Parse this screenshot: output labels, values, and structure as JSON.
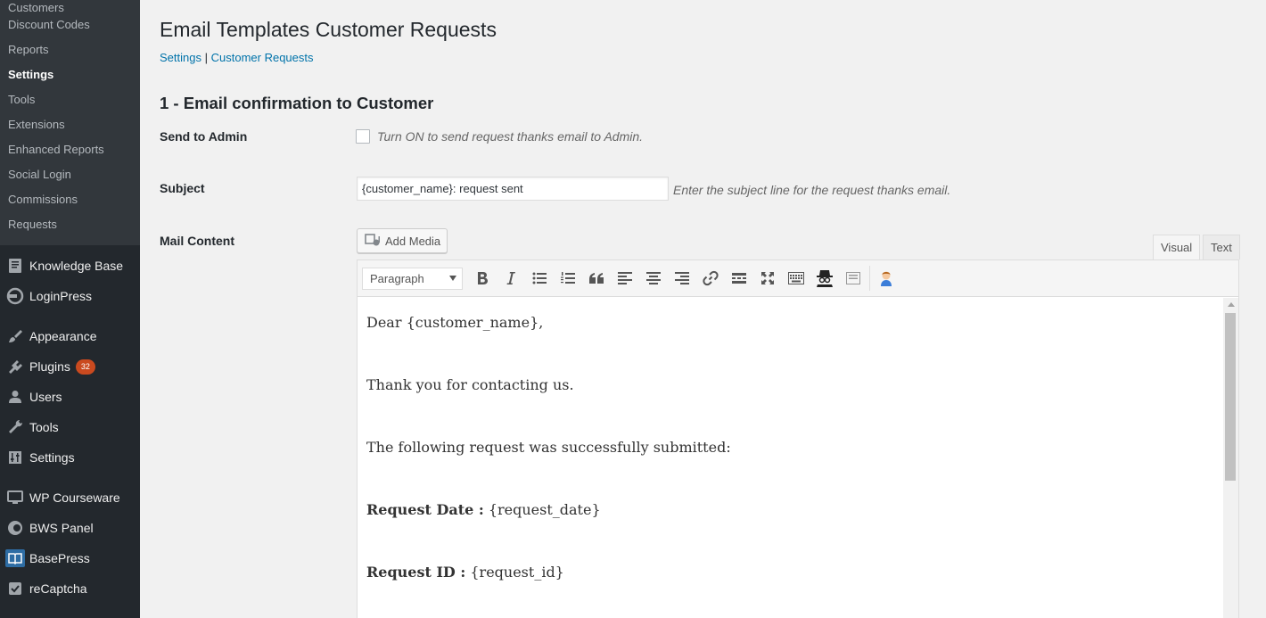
{
  "sidebar": {
    "submenu": [
      {
        "label": "Customers",
        "active": false
      },
      {
        "label": "Discount Codes",
        "active": false
      },
      {
        "label": "Reports",
        "active": false
      },
      {
        "label": "Settings",
        "active": true
      },
      {
        "label": "Tools",
        "active": false
      },
      {
        "label": "Extensions",
        "active": false
      },
      {
        "label": "Enhanced Reports",
        "active": false
      },
      {
        "label": "Social Login",
        "active": false
      },
      {
        "label": "Commissions",
        "active": false
      },
      {
        "label": "Requests",
        "active": false
      }
    ],
    "menu": [
      {
        "label": "Knowledge Base",
        "icon": "knowledge-base-icon"
      },
      {
        "label": "LoginPress",
        "icon": "loginpress-icon"
      },
      {
        "label": "Appearance",
        "icon": "paintbrush-icon"
      },
      {
        "label": "Plugins",
        "icon": "plugin-icon",
        "badge": "32"
      },
      {
        "label": "Users",
        "icon": "users-icon"
      },
      {
        "label": "Tools",
        "icon": "wrench-icon"
      },
      {
        "label": "Settings",
        "icon": "settings-icon"
      },
      {
        "label": "WP Courseware",
        "icon": "monitor-icon"
      },
      {
        "label": "BWS Panel",
        "icon": "bws-icon"
      },
      {
        "label": "BasePress",
        "icon": "book-icon"
      },
      {
        "label": "reCaptcha",
        "icon": "checkbox-icon"
      }
    ]
  },
  "page": {
    "title": "Email Templates Customer Requests",
    "crumbs": {
      "link1": "Settings",
      "sep": "|",
      "link2": "Customer Requests"
    },
    "section_title": "1 - Email confirmation to Customer"
  },
  "form": {
    "send_to_admin": {
      "label": "Send to Admin",
      "checked": false,
      "description": "Turn ON to send request thanks email to Admin."
    },
    "subject": {
      "label": "Subject",
      "value": "{customer_name}: request sent",
      "description": "Enter the subject line for the request thanks email."
    },
    "mail_content": {
      "label": "Mail Content",
      "add_media": "Add Media",
      "tabs": {
        "visual": "Visual",
        "text": "Text"
      },
      "format": "Paragraph",
      "lines": {
        "greeting": "Dear {customer_name},",
        "thanks": "Thank you for contacting us.",
        "intro": "The following request was successfully submitted:",
        "date_label": "Request Date :",
        "date_value": " {request_date}",
        "id_label": "Request ID :",
        "id_value": " {request_id}"
      }
    }
  }
}
